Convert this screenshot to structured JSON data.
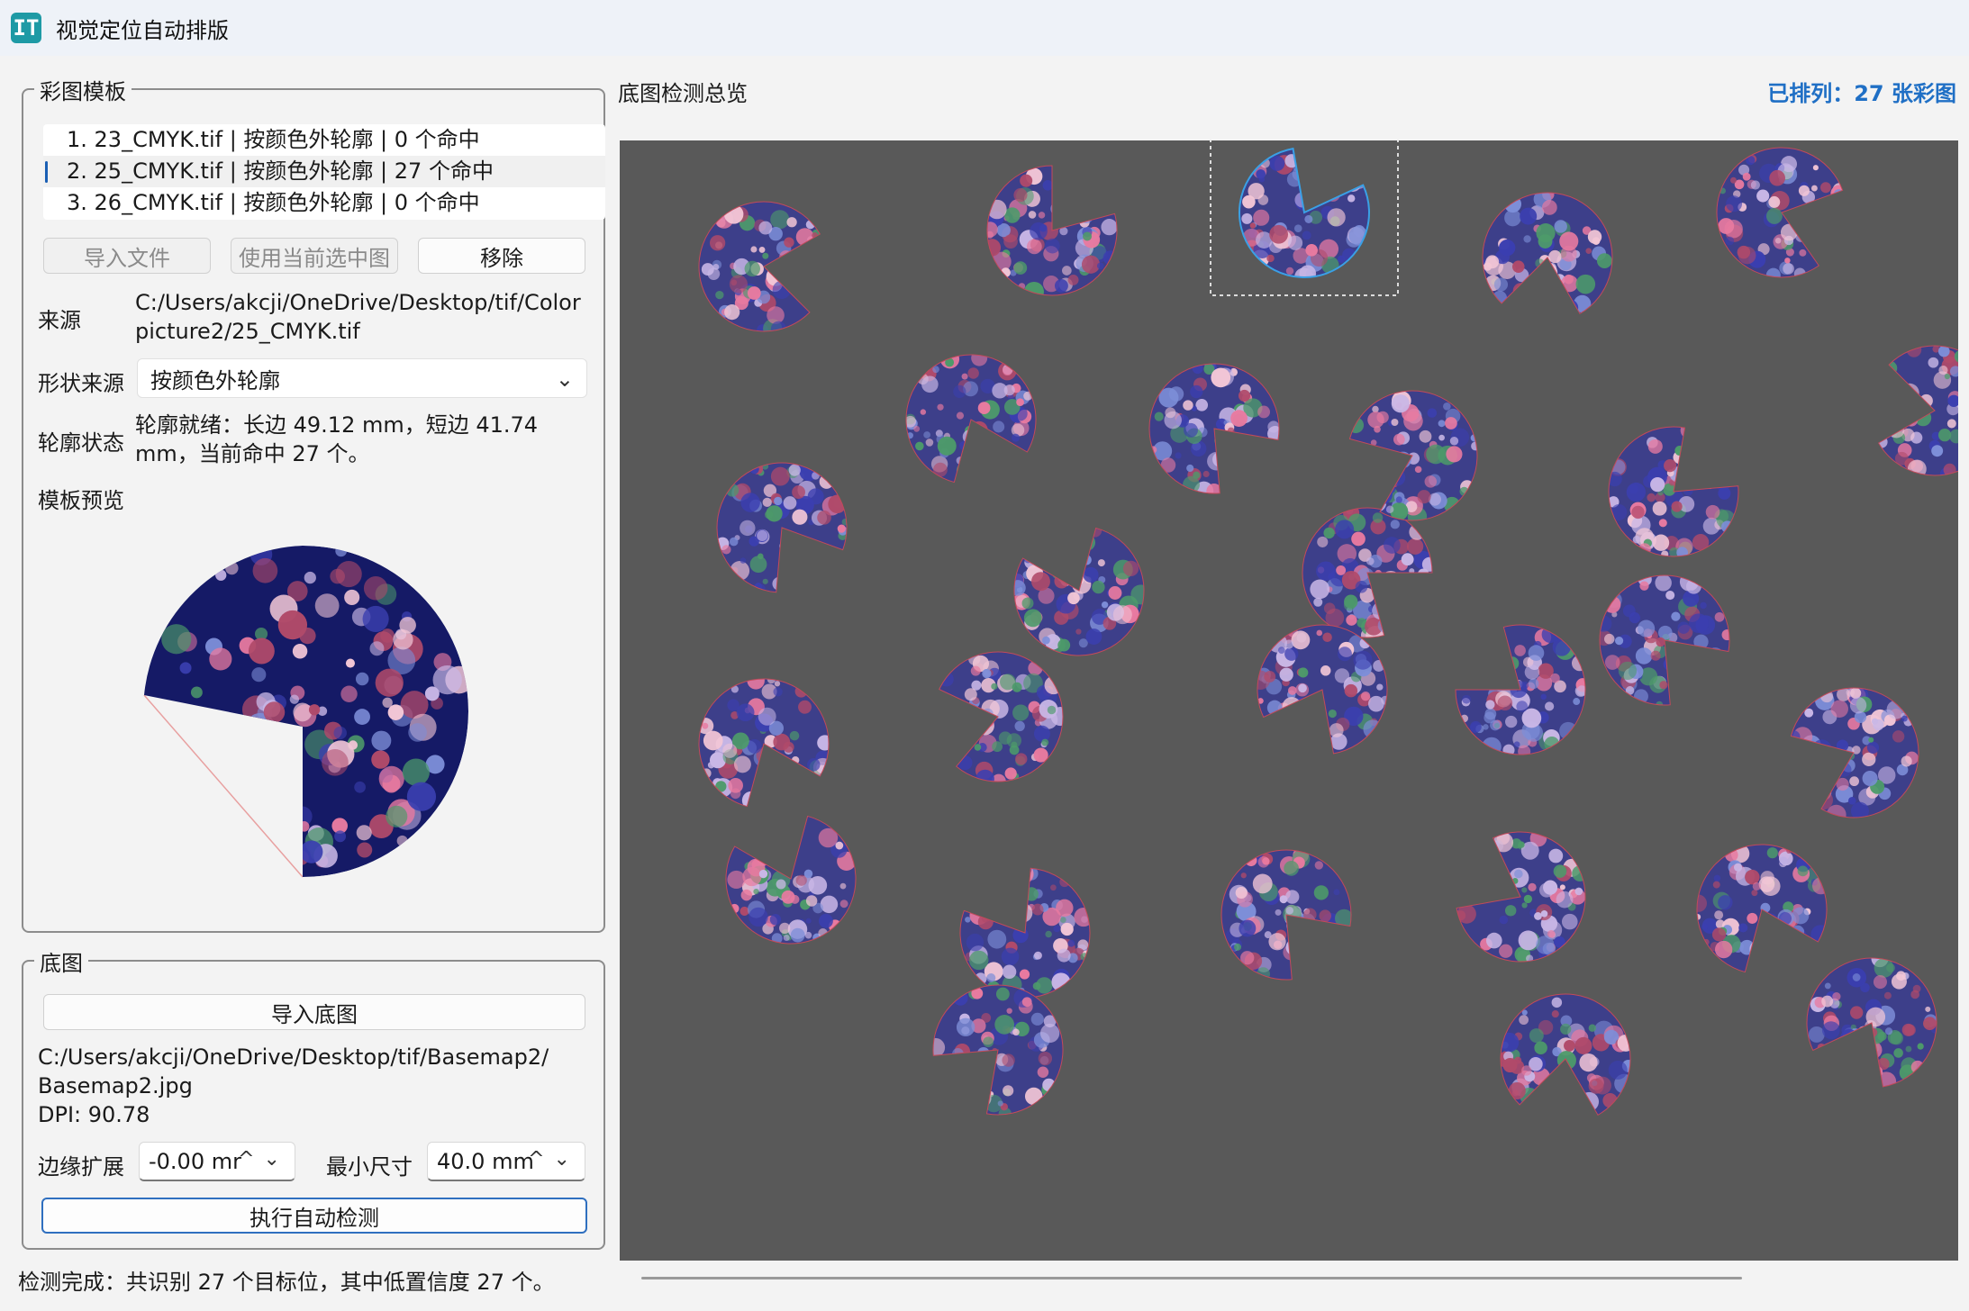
{
  "window": {
    "title": "视觉定位自动排版",
    "icon": "IT"
  },
  "template_group": {
    "legend": "彩图模板",
    "items": [
      {
        "label": "1. 23_CMYK.tif | 按颜色外轮廓 | 0 个命中"
      },
      {
        "label": "2. 25_CMYK.tif | 按颜色外轮廓 | 27 个命中"
      },
      {
        "label": "3. 26_CMYK.tif | 按颜色外轮廓 | 0 个命中"
      }
    ],
    "selected_index": 1,
    "buttons": {
      "import": "导入文件",
      "use_selected": "使用当前选中图",
      "remove": "移除"
    },
    "source_label": "来源",
    "source_line1": "C:/Users/akcji/OneDrive/Desktop/tif/Color",
    "source_line2": "picture2/25_CMYK.tif",
    "shape_source_label": "形状来源",
    "shape_source_value": "按颜色外轮廓",
    "contour_status_label": "轮廓状态",
    "contour_status_line1": "轮廓就绪：长边 49.12 mm，短边 41.74",
    "contour_status_line2": "mm，当前命中 27 个。",
    "preview_label": "模板预览"
  },
  "base_group": {
    "legend": "底图",
    "import_button": "导入底图",
    "path_line1": "C:/Users/akcji/OneDrive/Desktop/tif/Basemap2/",
    "path_line2": "Basemap2.jpg",
    "dpi": "DPI: 90.78",
    "edge_expand_label": "边缘扩展",
    "edge_expand_value": "-0.00 mr",
    "min_size_label": "最小尺寸",
    "min_size_value": "40.0 mm",
    "run_button": "执行自动检测"
  },
  "status_text": "检测完成：共识别 27 个目标位，其中低置信度 27 个。",
  "overview": {
    "title": "底图检测总览",
    "placed_count": "已排列：27 张彩图"
  },
  "colors": {
    "accent": "#1f6fc5",
    "canvas_bg": "#595959",
    "fabric_dark": "#151a66",
    "fabric_blue": "#3b3fb0",
    "flower_pink": "#e87aa0",
    "flower_light": "#c9b7e6",
    "cutout_outline": "#c24a5a"
  }
}
